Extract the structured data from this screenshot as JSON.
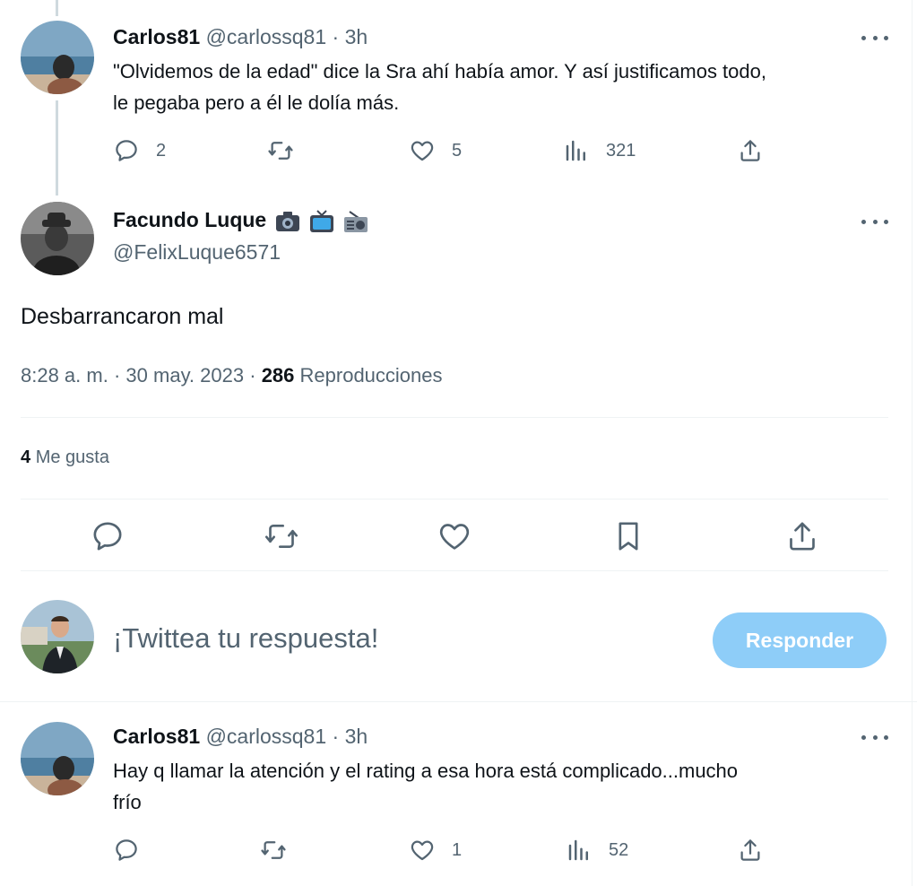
{
  "colors": {
    "accent": "#1d9bf0",
    "reply_button_bg": "#8ecdf8",
    "muted": "#536471",
    "divider": "#eff3f4"
  },
  "reply1": {
    "author_name": "Carlos81",
    "handle": "@carlossq81",
    "separator": "·",
    "time": "3h",
    "text_line1": "\"Olvidemos de la edad\" dice la Sra ahí había amor. Y así justificamos todo,",
    "text_line2": "le pegaba pero a él le dolía más.",
    "replies": "2",
    "retweets": "",
    "likes": "5",
    "views": "321"
  },
  "main_tweet": {
    "author_name": "Facundo Luque",
    "name_emojis": [
      "camera-emoji",
      "tv-emoji",
      "radio-emoji"
    ],
    "handle": "@FelixLuque6571",
    "text": "Desbarrancaron mal",
    "time": "8:28 a. m.",
    "separator": "·",
    "date": "30 may. 2023",
    "views_count": "286",
    "views_label": "Reproducciones",
    "likes_count": "4",
    "likes_label": "Me gusta"
  },
  "composer": {
    "placeholder": "¡Twittea tu respuesta!",
    "button_label": "Responder"
  },
  "reply2": {
    "author_name": "Carlos81",
    "handle": "@carlossq81",
    "separator": "·",
    "time": "3h",
    "text_line1": "Hay q llamar la atención y el rating a esa hora está complicado...mucho",
    "text_line2": "frío",
    "replies": "",
    "retweets": "",
    "likes": "1",
    "views": "52"
  }
}
